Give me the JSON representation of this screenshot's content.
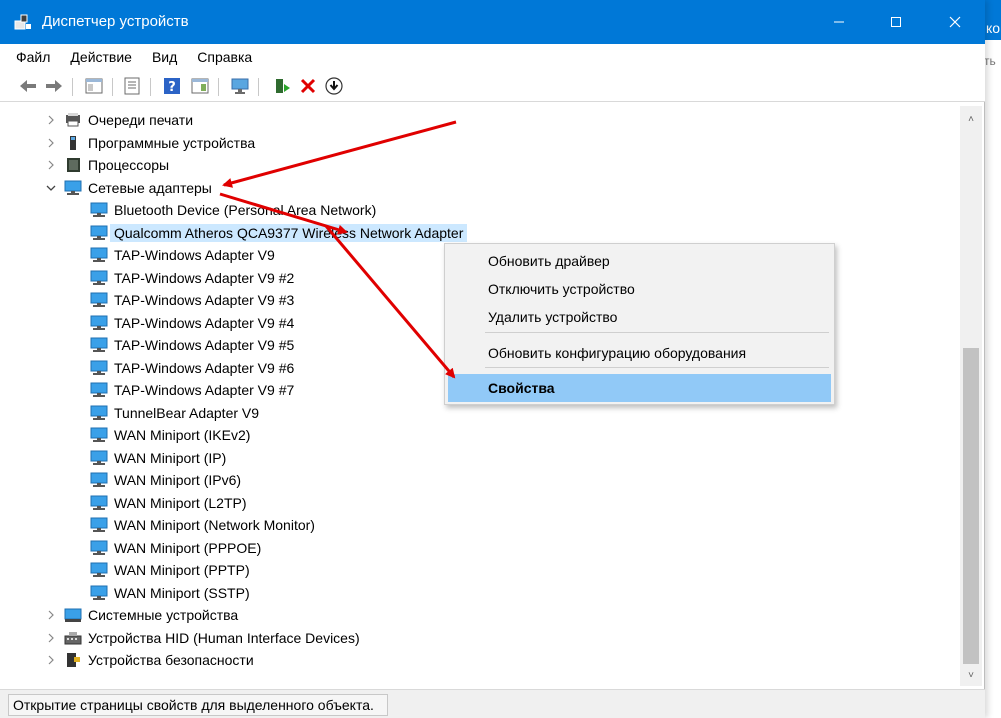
{
  "window": {
    "title": "Диспетчер устройств"
  },
  "background_window": {
    "title_fragment": "ко",
    "sub_fragment": "ть"
  },
  "menu": [
    "Файл",
    "Действие",
    "Вид",
    "Справка"
  ],
  "tree": [
    {
      "label": "Очереди печати",
      "expanded": false,
      "icon": "print-queue-icon"
    },
    {
      "label": "Программные устройства",
      "expanded": false,
      "icon": "software-device-icon"
    },
    {
      "label": "Процессоры",
      "expanded": false,
      "icon": "processor-icon"
    },
    {
      "label": "Сетевые адаптеры",
      "expanded": true,
      "icon": "network-adapter-icon"
    },
    {
      "label": "Bluetooth Device (Personal Area Network)",
      "child": true
    },
    {
      "label": "Qualcomm Atheros QCA9377 Wireless Network Adapter",
      "child": true,
      "selected": true
    },
    {
      "label": "TAP-Windows Adapter V9",
      "child": true
    },
    {
      "label": "TAP-Windows Adapter V9 #2",
      "child": true
    },
    {
      "label": "TAP-Windows Adapter V9 #3",
      "child": true
    },
    {
      "label": "TAP-Windows Adapter V9 #4",
      "child": true
    },
    {
      "label": "TAP-Windows Adapter V9 #5",
      "child": true
    },
    {
      "label": "TAP-Windows Adapter V9 #6",
      "child": true
    },
    {
      "label": "TAP-Windows Adapter V9 #7",
      "child": true
    },
    {
      "label": "TunnelBear Adapter V9",
      "child": true
    },
    {
      "label": "WAN Miniport (IKEv2)",
      "child": true
    },
    {
      "label": "WAN Miniport (IP)",
      "child": true
    },
    {
      "label": "WAN Miniport (IPv6)",
      "child": true
    },
    {
      "label": "WAN Miniport (L2TP)",
      "child": true
    },
    {
      "label": "WAN Miniport (Network Monitor)",
      "child": true
    },
    {
      "label": "WAN Miniport (PPPOE)",
      "child": true
    },
    {
      "label": "WAN Miniport (PPTP)",
      "child": true
    },
    {
      "label": "WAN Miniport (SSTP)",
      "child": true
    },
    {
      "label": "Системные устройства",
      "expanded": false,
      "icon": "system-device-icon"
    },
    {
      "label": "Устройства HID (Human Interface Devices)",
      "expanded": false,
      "icon": "hid-device-icon"
    },
    {
      "label": "Устройства безопасности",
      "expanded": false,
      "icon": "security-device-icon"
    }
  ],
  "context_menu": [
    {
      "label": "Обновить драйвер"
    },
    {
      "label": "Отключить устройство"
    },
    {
      "label": "Удалить устройство"
    },
    {
      "separator": true
    },
    {
      "label": "Обновить конфигурацию оборудования"
    },
    {
      "separator": true
    },
    {
      "label": "Свойства",
      "active": true
    }
  ],
  "status": {
    "text": "Открытие страницы свойств для выделенного объекта."
  },
  "colors": {
    "titlebar": "#0078d7",
    "selection": "#cce8ff",
    "menu_highlight": "#91c9f7",
    "annotation_arrow": "#e00000"
  }
}
